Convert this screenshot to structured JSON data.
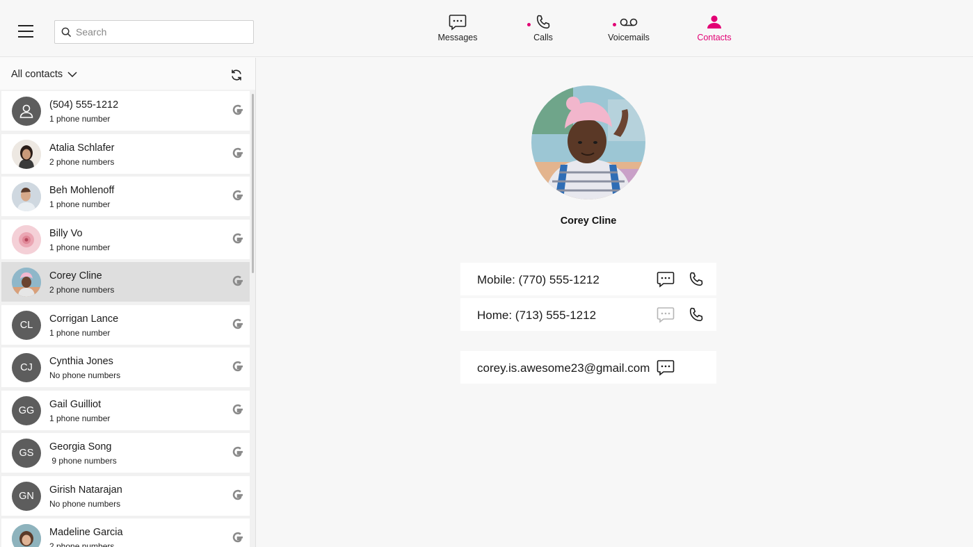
{
  "header": {
    "search_placeholder": "Search",
    "nav": [
      {
        "label": "Messages",
        "icon": "message-icon",
        "active": false,
        "badge": false
      },
      {
        "label": "Calls",
        "icon": "phone-icon",
        "active": false,
        "badge": true
      },
      {
        "label": "Voicemails",
        "icon": "voicemail-icon",
        "active": false,
        "badge": true
      },
      {
        "label": "Contacts",
        "icon": "contacts-icon",
        "active": true,
        "badge": false
      }
    ]
  },
  "sidebar": {
    "filter_label": "All contacts",
    "contacts": [
      {
        "name": "(504) 555-1212",
        "sub": "1 phone number",
        "initials": "",
        "avatar": "person-icon"
      },
      {
        "name": "Atalia Schlafer",
        "sub": "2 phone numbers",
        "initials": "",
        "avatar": "photo"
      },
      {
        "name": "Beh Mohlenoff",
        "sub": "1 phone number",
        "initials": "",
        "avatar": "photo"
      },
      {
        "name": "Billy Vo",
        "sub": "1 phone number",
        "initials": "",
        "avatar": "photo"
      },
      {
        "name": "Corey Cline",
        "sub": "2 phone numbers",
        "initials": "",
        "avatar": "photo"
      },
      {
        "name": "Corrigan Lance",
        "sub": "1 phone number",
        "initials": "CL",
        "avatar": "initials"
      },
      {
        "name": "Cynthia Jones",
        "sub": "No phone numbers",
        "initials": "CJ",
        "avatar": "initials"
      },
      {
        "name": "Gail Guilliot",
        "sub": "1 phone number",
        "initials": "GG",
        "avatar": "initials"
      },
      {
        "name": "Georgia Song",
        "sub": " 9 phone numbers",
        "initials": "GS",
        "avatar": "initials"
      },
      {
        "name": "Girish Natarajan",
        "sub": "No phone numbers",
        "initials": "GN",
        "avatar": "initials"
      },
      {
        "name": "Madeline Garcia",
        "sub": "2 phone numbers",
        "initials": "",
        "avatar": "photo"
      }
    ]
  },
  "detail": {
    "name": "Corey Cline",
    "phones": [
      {
        "label": "Mobile: (770) 555-1212",
        "message_enabled": true
      },
      {
        "label": "Home: (713) 555-1212",
        "message_enabled": false
      }
    ],
    "email": "corey.is.awesome23@gmail.com"
  },
  "colors": {
    "accent": "#e20074",
    "selected_row": "#dedede",
    "avatar_bg": "#5d5d5d"
  }
}
